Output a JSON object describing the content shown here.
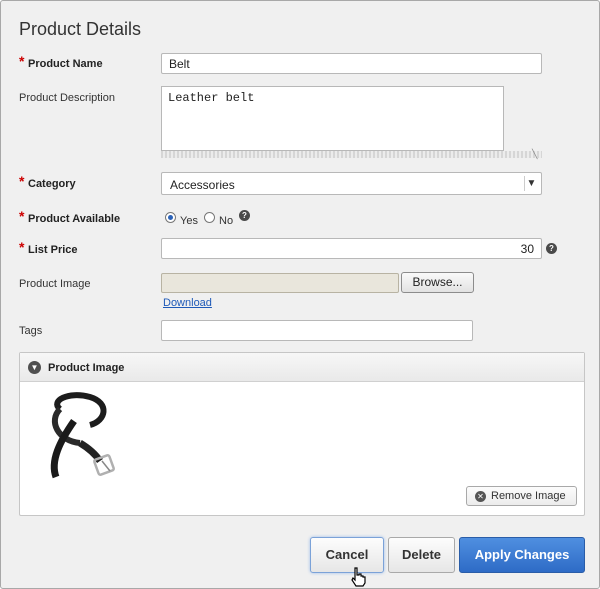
{
  "title": "Product Details",
  "form": {
    "product_name": {
      "label": "Product Name",
      "value": "Belt"
    },
    "product_description": {
      "label": "Product Description",
      "value": "Leather belt"
    },
    "category": {
      "label": "Category",
      "value": "Accessories"
    },
    "product_available": {
      "label": "Product Available",
      "yes": "Yes",
      "no": "No",
      "selected": "Yes"
    },
    "list_price": {
      "label": "List Price",
      "value": "30"
    },
    "product_image": {
      "label": "Product Image",
      "browse": "Browse...",
      "download": "Download"
    },
    "tags": {
      "label": "Tags",
      "value": ""
    }
  },
  "image_region": {
    "title": "Product Image",
    "remove_label": "Remove Image"
  },
  "buttons": {
    "cancel": "Cancel",
    "delete": "Delete",
    "apply": "Apply Changes"
  },
  "icons": {
    "required": "*",
    "help": "?",
    "collapse": "chevron-down-icon",
    "remove": "x-circle-icon"
  },
  "colors": {
    "required": "#cc0000",
    "link": "#1f5ab8",
    "primary": "#2e6bc6"
  }
}
